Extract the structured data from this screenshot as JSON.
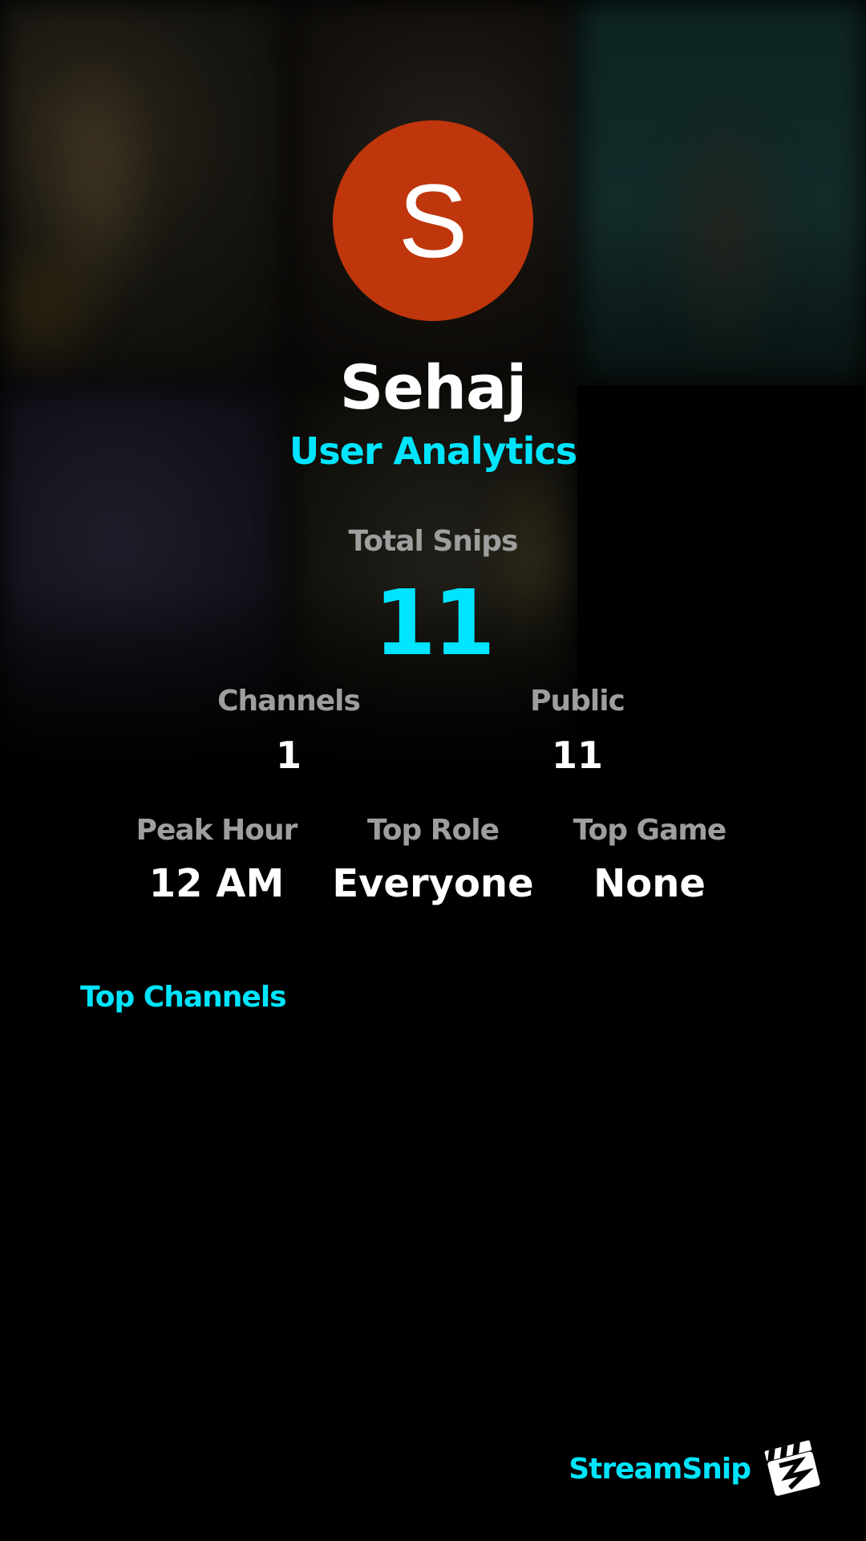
{
  "profile": {
    "avatar_initial": "S",
    "avatar_color": "#bf360c",
    "username": "Sehaj",
    "subtitle": "User Analytics"
  },
  "totals": {
    "label": "Total Snips",
    "value": "11"
  },
  "stats_row_1": [
    {
      "label": "Channels",
      "value": "1"
    },
    {
      "label": "Public",
      "value": "11"
    }
  ],
  "stats_row_2": [
    {
      "label": "Peak Hour",
      "value": "12 AM"
    },
    {
      "label": "Top Role",
      "value": "Everyone"
    },
    {
      "label": "Top Game",
      "value": "None"
    }
  ],
  "sections": {
    "top_channels_title": "Top Channels"
  },
  "brand": {
    "name": "StreamSnip",
    "logo_icon": "clapperboard-icon"
  },
  "colors": {
    "accent": "#00e5ff",
    "label_gray": "#9e9e9e",
    "background": "#000000"
  }
}
